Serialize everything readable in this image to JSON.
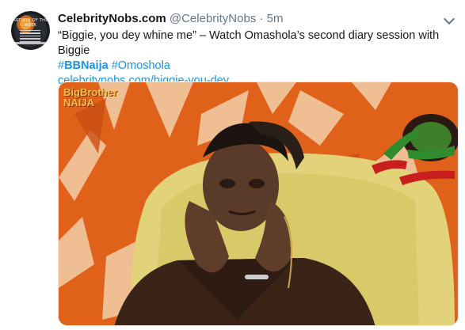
{
  "tweet": {
    "author_name": "CelebrityNobs.com",
    "handle": "@CelebrityNobs",
    "separator": "·",
    "time": "5m",
    "text_quote": "“Biggie, you dey whine me” – Watch Omashola’s second diary session with Biggie",
    "hashtag_symbol_1": "#",
    "hashtag_1": "BBNaija",
    "hashtag_2": "#Omoshola",
    "link": "celebritynobs.com/biggie-you-dey…"
  },
  "avatar": {
    "label": "ARTISTE OF THE WEEK"
  },
  "media": {
    "logo_line1": "BigBrother",
    "logo_line2": "NAIJA"
  },
  "colors": {
    "link_blue": "#1b95e0",
    "text_dark": "#14171a",
    "muted_gray": "#657786",
    "wall_orange": "#e0621a"
  },
  "icons": {
    "more": "chevron-down-icon"
  }
}
